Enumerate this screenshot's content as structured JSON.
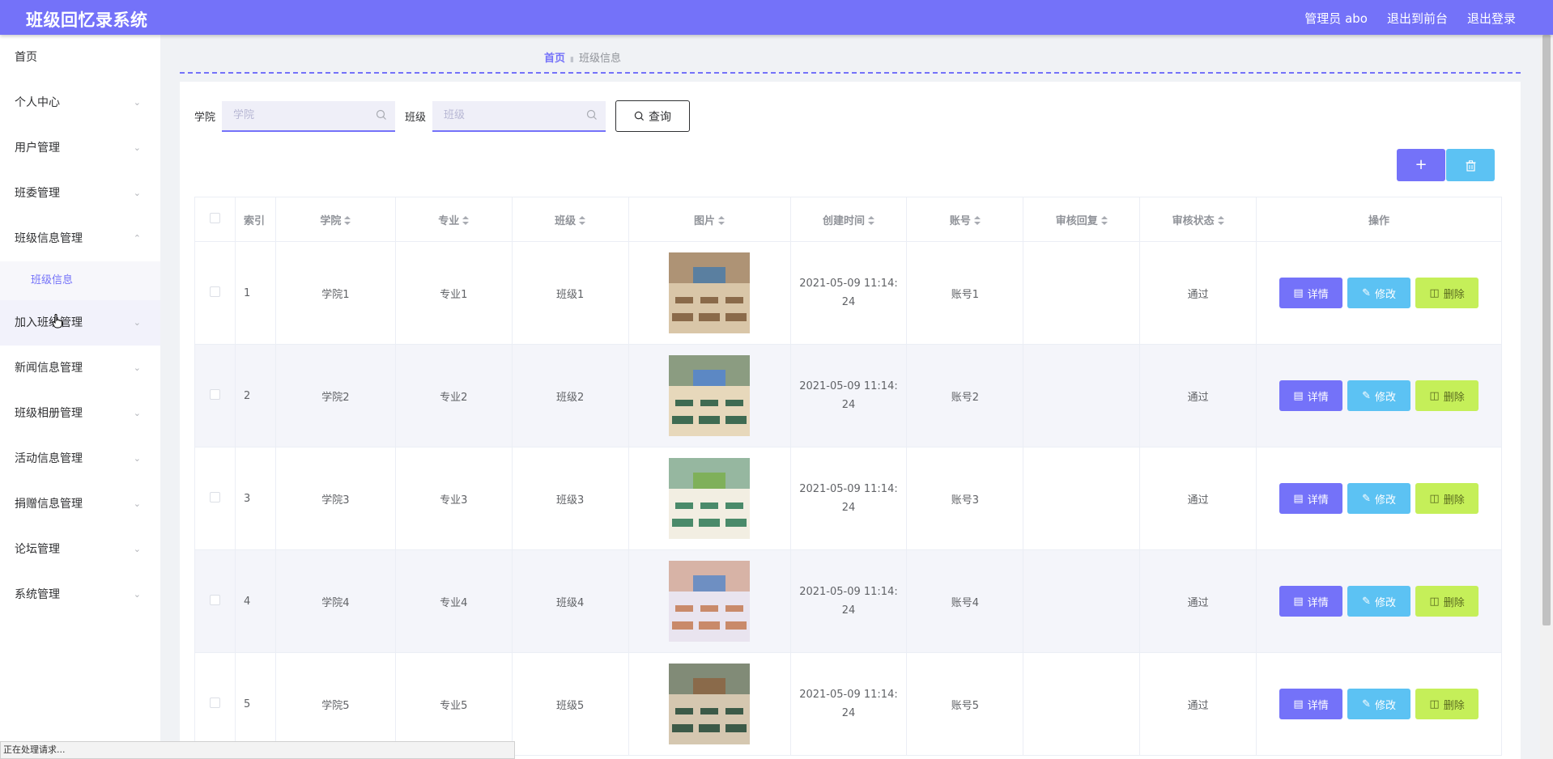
{
  "topbar": {
    "title": "班级回忆录系统",
    "admin": "管理员 abo",
    "front": "退出到前台",
    "logout": "退出登录"
  },
  "sidebar": {
    "items": [
      {
        "label": "首页",
        "chevron": false
      },
      {
        "label": "个人中心",
        "chevron": true
      },
      {
        "label": "用户管理",
        "chevron": true
      },
      {
        "label": "班委管理",
        "chevron": true
      },
      {
        "label": "班级信息管理",
        "chevron": true,
        "expanded": true
      },
      {
        "label": "加入班级管理",
        "chevron": true
      },
      {
        "label": "新闻信息管理",
        "chevron": true
      },
      {
        "label": "班级相册管理",
        "chevron": true
      },
      {
        "label": "活动信息管理",
        "chevron": true
      },
      {
        "label": "捐赠信息管理",
        "chevron": true
      },
      {
        "label": "论坛管理",
        "chevron": true
      },
      {
        "label": "系统管理",
        "chevron": true
      }
    ],
    "sub_item": "班级信息"
  },
  "breadcrumb": {
    "home": "首页",
    "current": "班级信息"
  },
  "search": {
    "college_label": "学院",
    "college_placeholder": "学院",
    "class_label": "班级",
    "class_placeholder": "班级",
    "query_label": "查询"
  },
  "table": {
    "headers": [
      "索引",
      "学院",
      "专业",
      "班级",
      "图片",
      "创建时间",
      "账号",
      "审核回复",
      "审核状态",
      "操作"
    ],
    "rows": [
      {
        "index": "1",
        "college": "学院1",
        "major": "专业1",
        "class": "班级1",
        "time_a": "2021-05-09 11:14:",
        "time_b": "24",
        "account": "账号1",
        "reply": "",
        "status": "通过"
      },
      {
        "index": "2",
        "college": "学院2",
        "major": "专业2",
        "class": "班级2",
        "time_a": "2021-05-09 11:14:",
        "time_b": "24",
        "account": "账号2",
        "reply": "",
        "status": "通过"
      },
      {
        "index": "3",
        "college": "学院3",
        "major": "专业3",
        "class": "班级3",
        "time_a": "2021-05-09 11:14:",
        "time_b": "24",
        "account": "账号3",
        "reply": "",
        "status": "通过"
      },
      {
        "index": "4",
        "college": "学院4",
        "major": "专业4",
        "class": "班级4",
        "time_a": "2021-05-09 11:14:",
        "time_b": "24",
        "account": "账号4",
        "reply": "",
        "status": "通过"
      },
      {
        "index": "5",
        "college": "学院5",
        "major": "专业5",
        "class": "班级5",
        "time_a": "2021-05-09 11:14:",
        "time_b": "24",
        "account": "账号5",
        "reply": "",
        "status": "通过"
      }
    ],
    "actions": {
      "detail": "详情",
      "edit": "修改",
      "delete": "删除"
    }
  },
  "status_bar": "正在处理请求...",
  "colors": {
    "accent": "#7472f9",
    "info": "#5cc2f3",
    "danger": "#c5ef59"
  }
}
